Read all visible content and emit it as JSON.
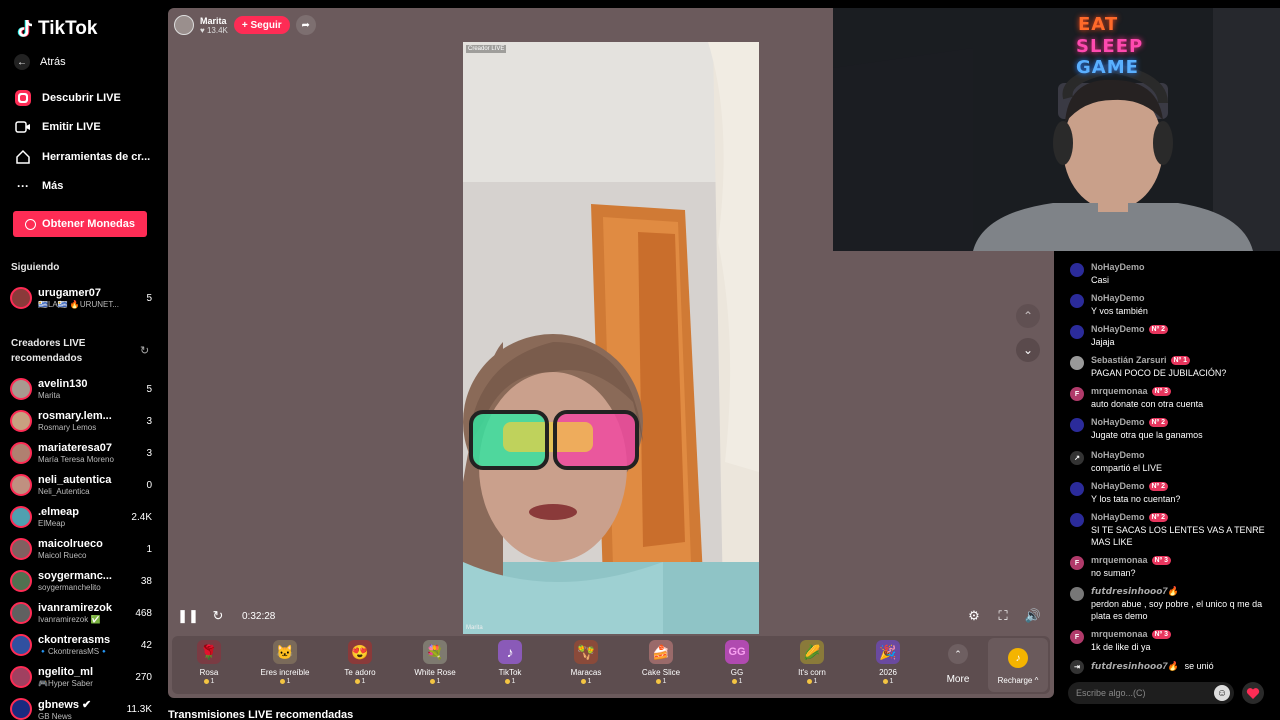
{
  "app": {
    "logo": "TikTok"
  },
  "sidebar": {
    "back": "Atrás",
    "nav": [
      {
        "label": "Descubrir LIVE",
        "icon": "live-icon"
      },
      {
        "label": "Emitir LIVE",
        "icon": "camera-icon"
      },
      {
        "label": "Herramientas de cr...",
        "icon": "tools-icon"
      },
      {
        "label": "Más",
        "icon": "more-icon"
      }
    ],
    "coins_button": "Obtener Monedas",
    "following_label": "Siguiendo",
    "following": [
      {
        "name": "urugamer07",
        "sub": "🇺🇾LA🇺🇾 🔥URUNET...",
        "count": "5"
      }
    ],
    "recommended_label": "Creadores LIVE recomendados",
    "recommended": [
      {
        "name": "avelin130",
        "sub": "Marita",
        "count": "5"
      },
      {
        "name": "rosmary.lem...",
        "sub": "Rosmary Lemos",
        "count": "3"
      },
      {
        "name": "mariateresa07",
        "sub": "María Teresa Moreno",
        "count": "3"
      },
      {
        "name": "neli_autentica",
        "sub": "Neli_Autentica",
        "count": "0"
      },
      {
        "name": ".elmeap",
        "sub": "ElMeap",
        "count": "2.4K"
      },
      {
        "name": "maicolrueco",
        "sub": "Maicol Rueco",
        "count": "1"
      },
      {
        "name": "soygermanc...",
        "sub": "soygermanchelito",
        "count": "38"
      },
      {
        "name": "ivanramirezok",
        "sub": "Ivanramirezok ✅",
        "count": "468"
      },
      {
        "name": "ckontrerasms",
        "sub": "🔹CkontrerasMS🔹",
        "count": "42"
      },
      {
        "name": "ngelito_ml",
        "sub": "🎮Hyper Saber",
        "count": "270"
      },
      {
        "name": "gbnews ✔",
        "sub": "GB News",
        "count": "11.3K"
      }
    ]
  },
  "stream": {
    "host_name": "Marita",
    "viewers": "13.4K",
    "follow_label": "+ Seguir",
    "video_tag": "Creador LIVE",
    "video_corner": "Marita",
    "time": "0:32:28"
  },
  "gifts": [
    {
      "name": "Rosa",
      "price": "1",
      "icon": "🌹",
      "bg": "#7a3b43"
    },
    {
      "name": "Eres increíble",
      "price": "1",
      "icon": "🐱",
      "bg": "#7a6a5a"
    },
    {
      "name": "Te adoro",
      "price": "1",
      "icon": "😍",
      "bg": "#8a3a3a"
    },
    {
      "name": "White Rose",
      "price": "1",
      "icon": "💐",
      "bg": "#7e7a70"
    },
    {
      "name": "TikTok",
      "price": "1",
      "icon": "♪",
      "bg": "#8a5ab8"
    },
    {
      "name": "Maracas",
      "price": "1",
      "icon": "🪇",
      "bg": "#8a4a3a"
    },
    {
      "name": "Cake Slice",
      "price": "1",
      "icon": "🍰",
      "bg": "#9a6a6a"
    },
    {
      "name": "GG",
      "price": "1",
      "icon": "GG",
      "bg": "#b04ab0"
    },
    {
      "name": "It's corn",
      "price": "1",
      "icon": "🌽",
      "bg": "#8a7a3a"
    },
    {
      "name": "2026",
      "price": "1",
      "icon": "🎉",
      "bg": "#6a4aa0"
    }
  ],
  "more_label": "More",
  "recharge_label": "Recharge ^",
  "bottom_heading": "Transmisiones LIVE recomendadas",
  "webcam": {
    "neon_1": "EAT",
    "neon_2": "SLEEP",
    "neon_3": "GAME"
  },
  "chat": {
    "messages": [
      {
        "user": "NoHayDemo",
        "badge": "",
        "text": "Casi",
        "avatar_color": "#2b2b9a",
        "avatar": ""
      },
      {
        "user": "NoHayDemo",
        "badge": "",
        "text": "Y vos también",
        "avatar_color": "#2b2b9a",
        "avatar": ""
      },
      {
        "user": "NoHayDemo",
        "badge": "Nº 2",
        "text": "Jajaja",
        "avatar_color": "#2b2b9a",
        "avatar": ""
      },
      {
        "user": "Sebastián Zarsuri",
        "badge": "Nº 1",
        "text": "PAGAN POCO DE JUBILACIÓN?",
        "avatar_color": "#999",
        "avatar": ""
      },
      {
        "user": "mrquemonaa",
        "badge": "Nº 3",
        "text": "auto donate con otra cuenta",
        "avatar_color": "#b03a6a",
        "avatar": "F"
      },
      {
        "user": "NoHayDemo",
        "badge": "Nº 2",
        "text": "Jugate otra que la ganamos",
        "avatar_color": "#2b2b9a",
        "avatar": ""
      },
      {
        "user": "NoHayDemo",
        "badge": "",
        "text": " compartió el LIVE",
        "avatar_color": "#333",
        "avatar": "↗"
      },
      {
        "user": "NoHayDemo",
        "badge": "Nº 2",
        "text": "Y los tata no cuentan?",
        "avatar_color": "#2b2b9a",
        "avatar": ""
      },
      {
        "user": "NoHayDemo",
        "badge": "Nº 2",
        "text": "SI TE SACAS LOS LENTES VAS A TENRE MAS LIKE",
        "avatar_color": "#2b2b9a",
        "avatar": ""
      },
      {
        "user": "mrquemonaa",
        "badge": "Nº 3",
        "text": "no suman?",
        "avatar_color": "#b03a6a",
        "avatar": "F"
      },
      {
        "user": "𝙛𝙪𝙩𝙙𝙧𝙚𝙨𝙞𝙣𝙝𝙤𝙤𝙤7🔥",
        "badge": "",
        "text": "perdon abue , soy pobre , el unico q me da plata es demo",
        "avatar_color": "#777",
        "avatar": ""
      },
      {
        "user": "mrquemonaa",
        "badge": "Nº 3",
        "text": "1k de like di ya",
        "avatar_color": "#b03a6a",
        "avatar": "F"
      }
    ],
    "joined_user": "𝙛𝙪𝙩𝙙𝙧𝙚𝙨𝙞𝙣𝙝𝙤𝙤𝙤7🔥",
    "joined_text": "se unió",
    "input_placeholder": "Escribe algo...(C)"
  }
}
